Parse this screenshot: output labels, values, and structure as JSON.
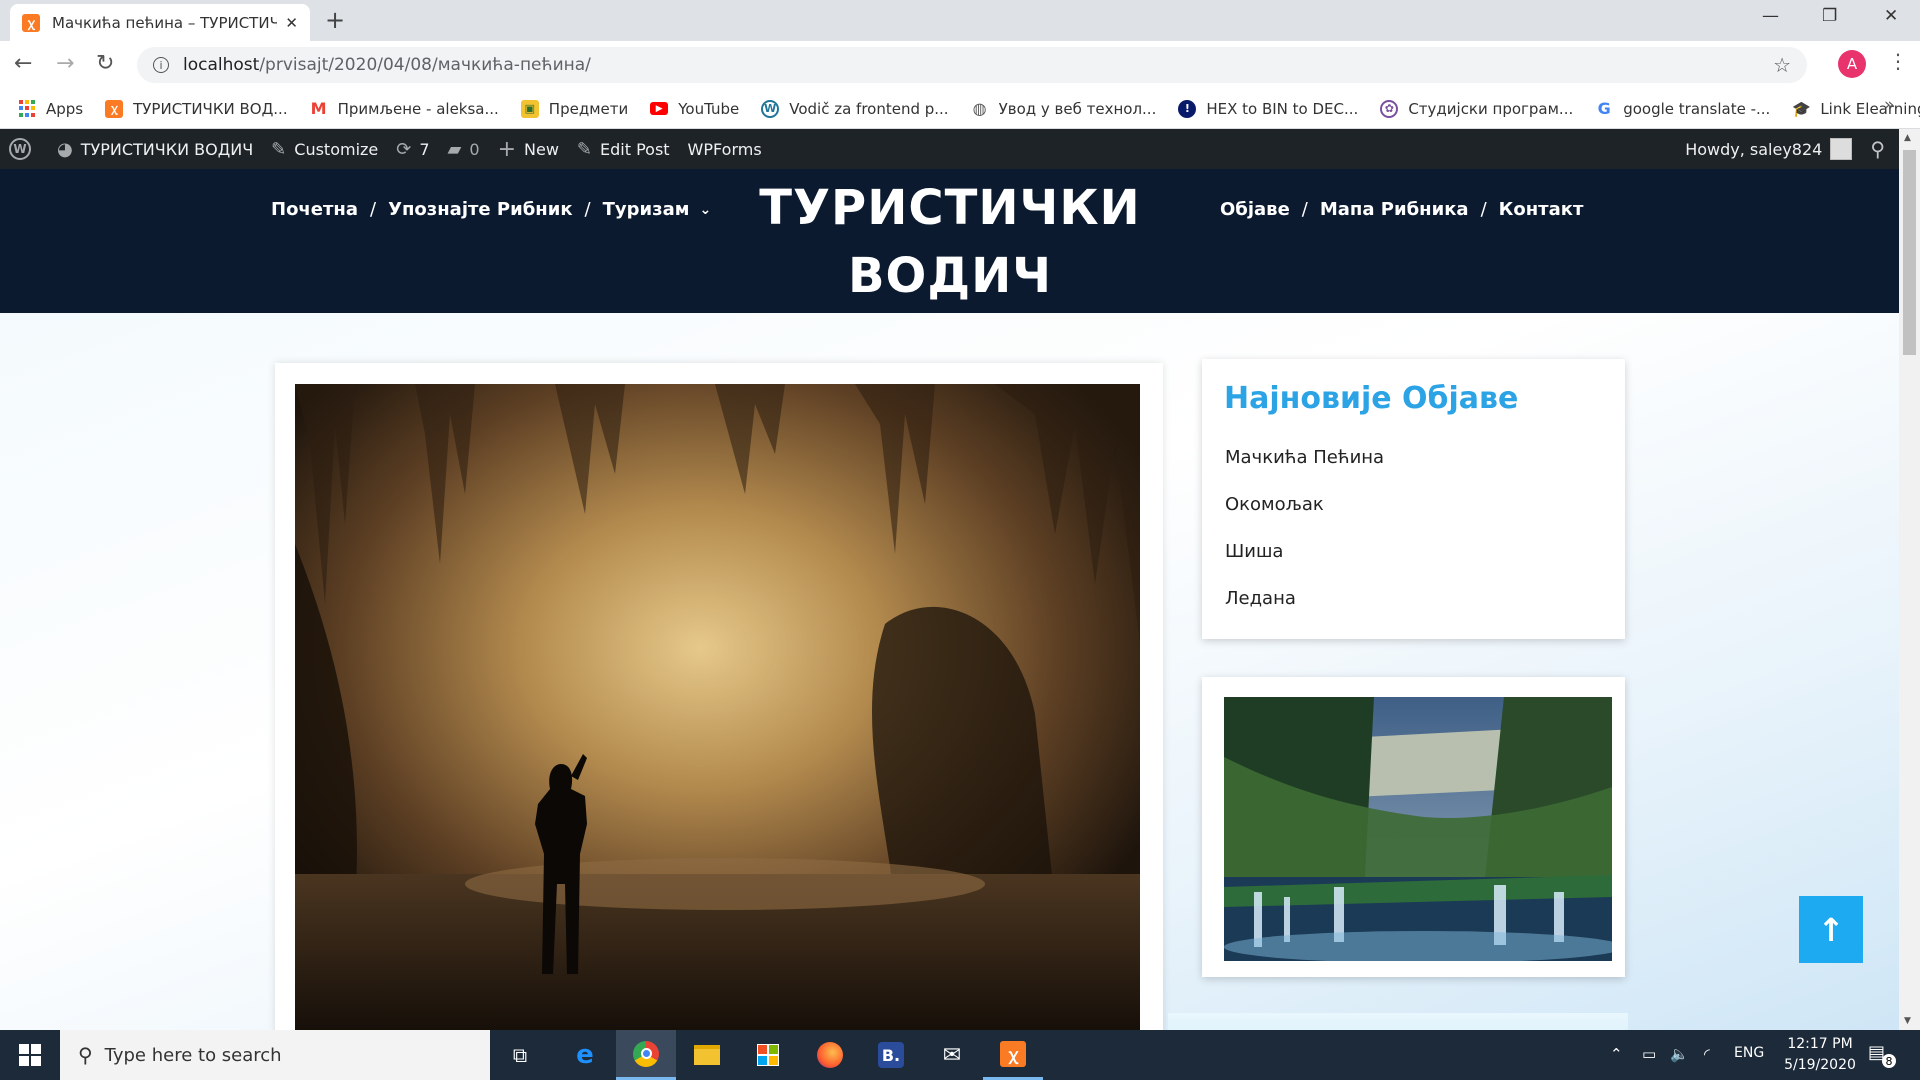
{
  "browser": {
    "tab_title": "Мачкића пећина – ТУРИСТИЧКИ",
    "address_host": "localhost",
    "address_path": "/prvisajt/2020/04/08/мачкића-пећина/",
    "profile_initial": "A",
    "bookmarks": [
      {
        "label": "Apps",
        "icon": "apps-grid-icon"
      },
      {
        "label": "ТУРИСТИЧКИ ВОД...",
        "icon": "xampp-icon"
      },
      {
        "label": "Примљене - aleksa...",
        "icon": "gmail-icon"
      },
      {
        "label": "Предмети",
        "icon": "folder-icon"
      },
      {
        "label": "YouTube",
        "icon": "youtube-icon"
      },
      {
        "label": "Vodič za frontend p...",
        "icon": "wordpress-icon"
      },
      {
        "label": "Увод у веб технол...",
        "icon": "globe-icon"
      },
      {
        "label": "HEX to BIN to DEC...",
        "icon": "hex-icon"
      },
      {
        "label": "Студијски програм...",
        "icon": "university-icon"
      },
      {
        "label": "google translate -...",
        "icon": "google-icon"
      },
      {
        "label": "Link Elearning",
        "icon": "elearning-icon"
      }
    ]
  },
  "adminbar": {
    "site_name": "ТУРИСТИЧКИ ВОДИЧ",
    "customize": "Customize",
    "updates_count": "7",
    "comments_count": "0",
    "new": "New",
    "edit_post": "Edit Post",
    "wpforms": "WPForms",
    "howdy": "Howdy, saley824"
  },
  "header": {
    "title_line1": "ТУРИСТИЧКИ",
    "title_line2": "ВОДИЧ",
    "menu_left": [
      "Почетна",
      "Упознајте Рибник",
      "Туризам"
    ],
    "menu_right": [
      "Објаве",
      "Мапа Рибника",
      "Контакт"
    ]
  },
  "sidebar": {
    "recent_title": "Најновије Објаве",
    "recent_posts": [
      "Мачкића Пећина",
      "Окомољак",
      "Шиша",
      "Ледана"
    ]
  },
  "taskbar": {
    "search_placeholder": "Type here to search",
    "lang": "ENG",
    "time": "12:17 PM",
    "date": "5/19/2020",
    "notifications": "8"
  },
  "colors": {
    "header_bg": "#0c1a30",
    "adminbar_bg": "#1d2327",
    "accent": "#2ba3e4",
    "scroll_top_button": "#1eaaf1"
  }
}
